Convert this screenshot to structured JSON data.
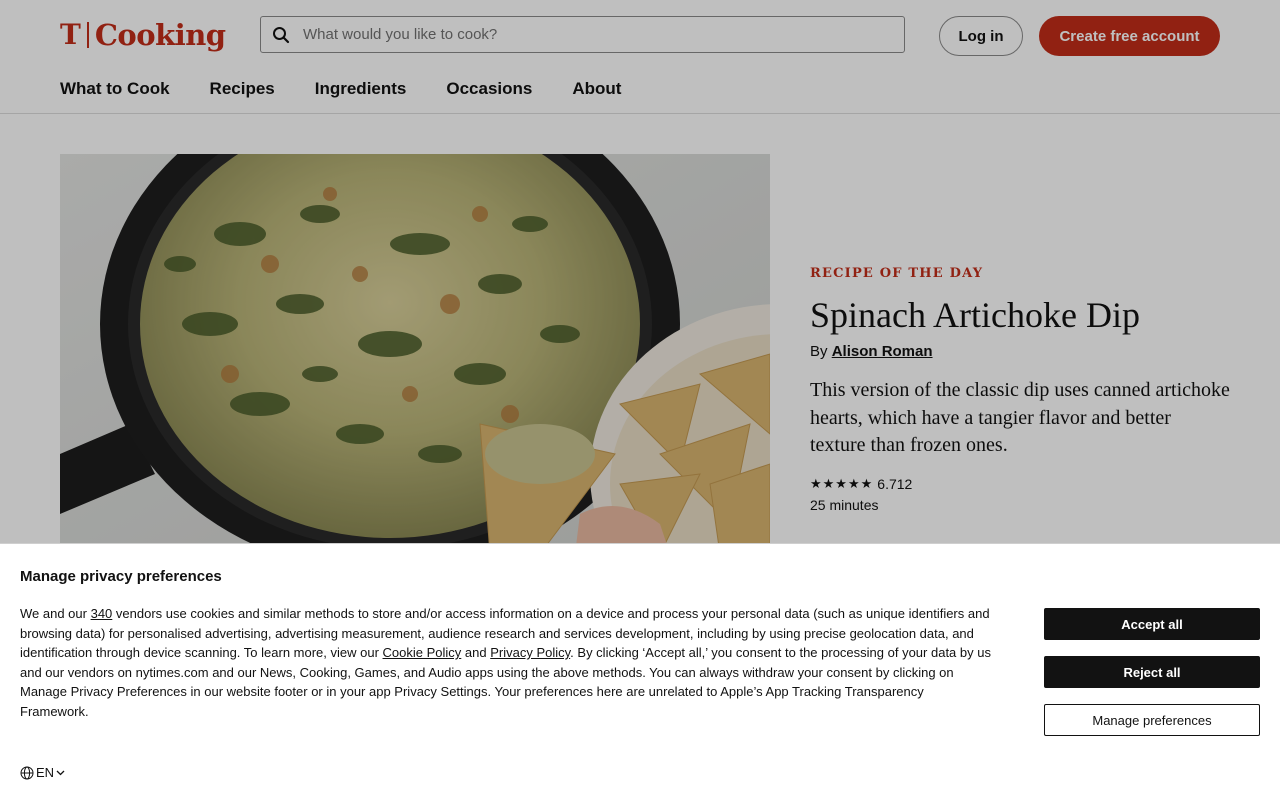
{
  "header": {
    "logo_mark": "T",
    "logo_word": "Cooking",
    "search_placeholder": "What would you like to cook?",
    "login_label": "Log in",
    "create_label": "Create free account",
    "nav": [
      "What to Cook",
      "Recipes",
      "Ingredients",
      "Occasions",
      "About"
    ]
  },
  "hero": {
    "kicker": "RECIPE OF THE DAY",
    "title": "Spinach Artichoke Dip",
    "by_prefix": "By",
    "author": "Alison Roman",
    "description": "This version of the classic dip uses canned artichoke hearts, which have a tangier flavor and better texture than frozen ones.",
    "stars": "★★★★★",
    "rating_count": "6.712",
    "time": "25 minutes"
  },
  "consent": {
    "title": "Manage privacy preferences",
    "text_1": "We and our ",
    "vendor_count": "340",
    "text_2": " vendors use cookies and similar methods to store and/or access information on a device and process your personal data (such as unique identifiers and browsing data) for personalised advertising, advertising measurement, audience research and services development, including by using precise geolocation data, and identification through device scanning. To learn more, view our ",
    "cookie_policy": "Cookie Policy",
    "text_3": " and ",
    "privacy_policy": "Privacy Policy",
    "text_4": ". By clicking ‘Accept all,’ you consent to the processing of your data by us and our vendors on nytimes.com and our News, Cooking, Games, and Audio apps using the above methods. You can always withdraw your consent by clicking on Manage Privacy Preferences in our website footer or in your app Privacy Settings. Your preferences here are unrelated to Apple’s App Tracking Transparency Framework.",
    "accept_label": "Accept all",
    "reject_label": "Reject all",
    "manage_label": "Manage preferences",
    "language": "EN"
  },
  "colors": {
    "brand": "#c22d19",
    "dark_button": "#121212"
  }
}
